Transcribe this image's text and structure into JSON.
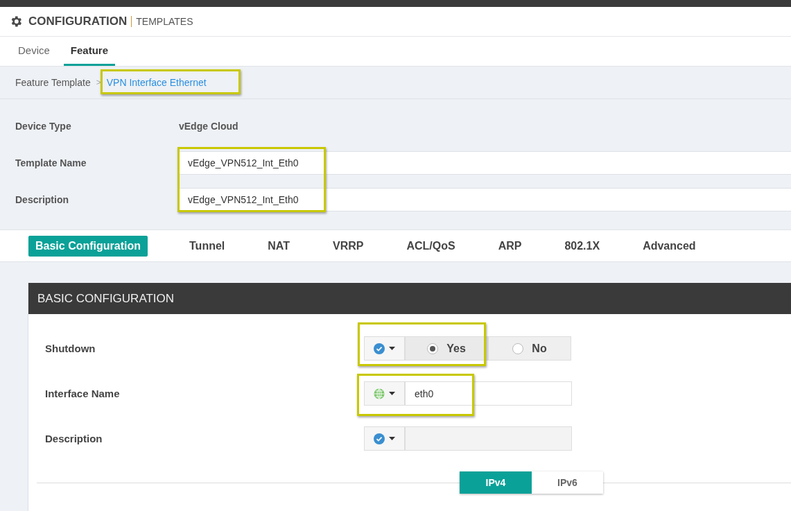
{
  "header": {
    "title": "CONFIGURATION",
    "subtitle": "TEMPLATES"
  },
  "tabs": [
    {
      "label": "Device",
      "selected": false
    },
    {
      "label": "Feature",
      "selected": true
    }
  ],
  "breadcrumb": {
    "parent": "Feature Template",
    "separator": ">",
    "current": "VPN Interface Ethernet",
    "highlighted": true
  },
  "template_form": {
    "fields_highlighted": true,
    "rows": [
      {
        "kind": "text",
        "label": "Device Type",
        "value": "vEdge Cloud"
      },
      {
        "kind": "input",
        "label": "Template Name",
        "value": "vEdge_VPN512_Int_Eth0"
      },
      {
        "kind": "input",
        "label": "Description",
        "value": "vEdge_VPN512_Int_Eth0"
      }
    ]
  },
  "section_tabs": [
    {
      "label": "Basic Configuration",
      "selected": true
    },
    {
      "label": "Tunnel",
      "selected": false
    },
    {
      "label": "NAT",
      "selected": false
    },
    {
      "label": "VRRP",
      "selected": false
    },
    {
      "label": "ACL/QoS",
      "selected": false
    },
    {
      "label": "ARP",
      "selected": false
    },
    {
      "label": "802.1X",
      "selected": false
    },
    {
      "label": "Advanced",
      "selected": false
    }
  ],
  "panel": {
    "title": "BASIC CONFIGURATION",
    "rows": [
      {
        "kind": "radio",
        "label": "Shutdown",
        "scope_selector": {
          "kind": "check"
        },
        "highlighted": true,
        "options": [
          {
            "label": "Yes",
            "selected": true
          },
          {
            "label": "No",
            "selected": false
          }
        ]
      },
      {
        "kind": "input",
        "label": "Interface Name",
        "scope_selector": {
          "kind": "globe"
        },
        "highlighted": true,
        "value": "eth0",
        "disabled": false
      },
      {
        "kind": "input",
        "label": "Description",
        "scope_selector": {
          "kind": "check"
        },
        "highlighted": false,
        "value": "",
        "disabled": true
      }
    ],
    "ip_toggle": [
      {
        "label": "IPv4",
        "selected": true
      },
      {
        "label": "IPv6",
        "selected": false
      }
    ]
  }
}
